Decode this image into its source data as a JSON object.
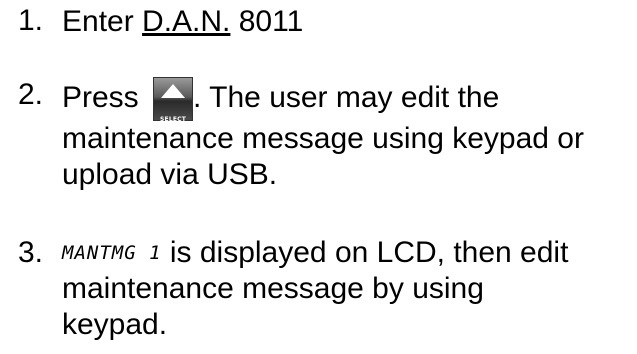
{
  "steps": [
    {
      "number": "1.",
      "prefix": "Enter ",
      "code": "D.A.N.",
      "suffix": " 8011"
    },
    {
      "number": "2.",
      "prefix": "Press ",
      "button_label": "SELECT",
      "suffix": ".  The user may edit the",
      "line2": "maintenance message using keypad or",
      "line3": "upload via USB."
    },
    {
      "number": "3.",
      "lcd_text": "MANTMG 1",
      "suffix": " is displayed on LCD, then edit",
      "line2": "maintenance message by using",
      "line3": "keypad."
    }
  ],
  "icons": {
    "select_button": "select-triangle-icon"
  }
}
